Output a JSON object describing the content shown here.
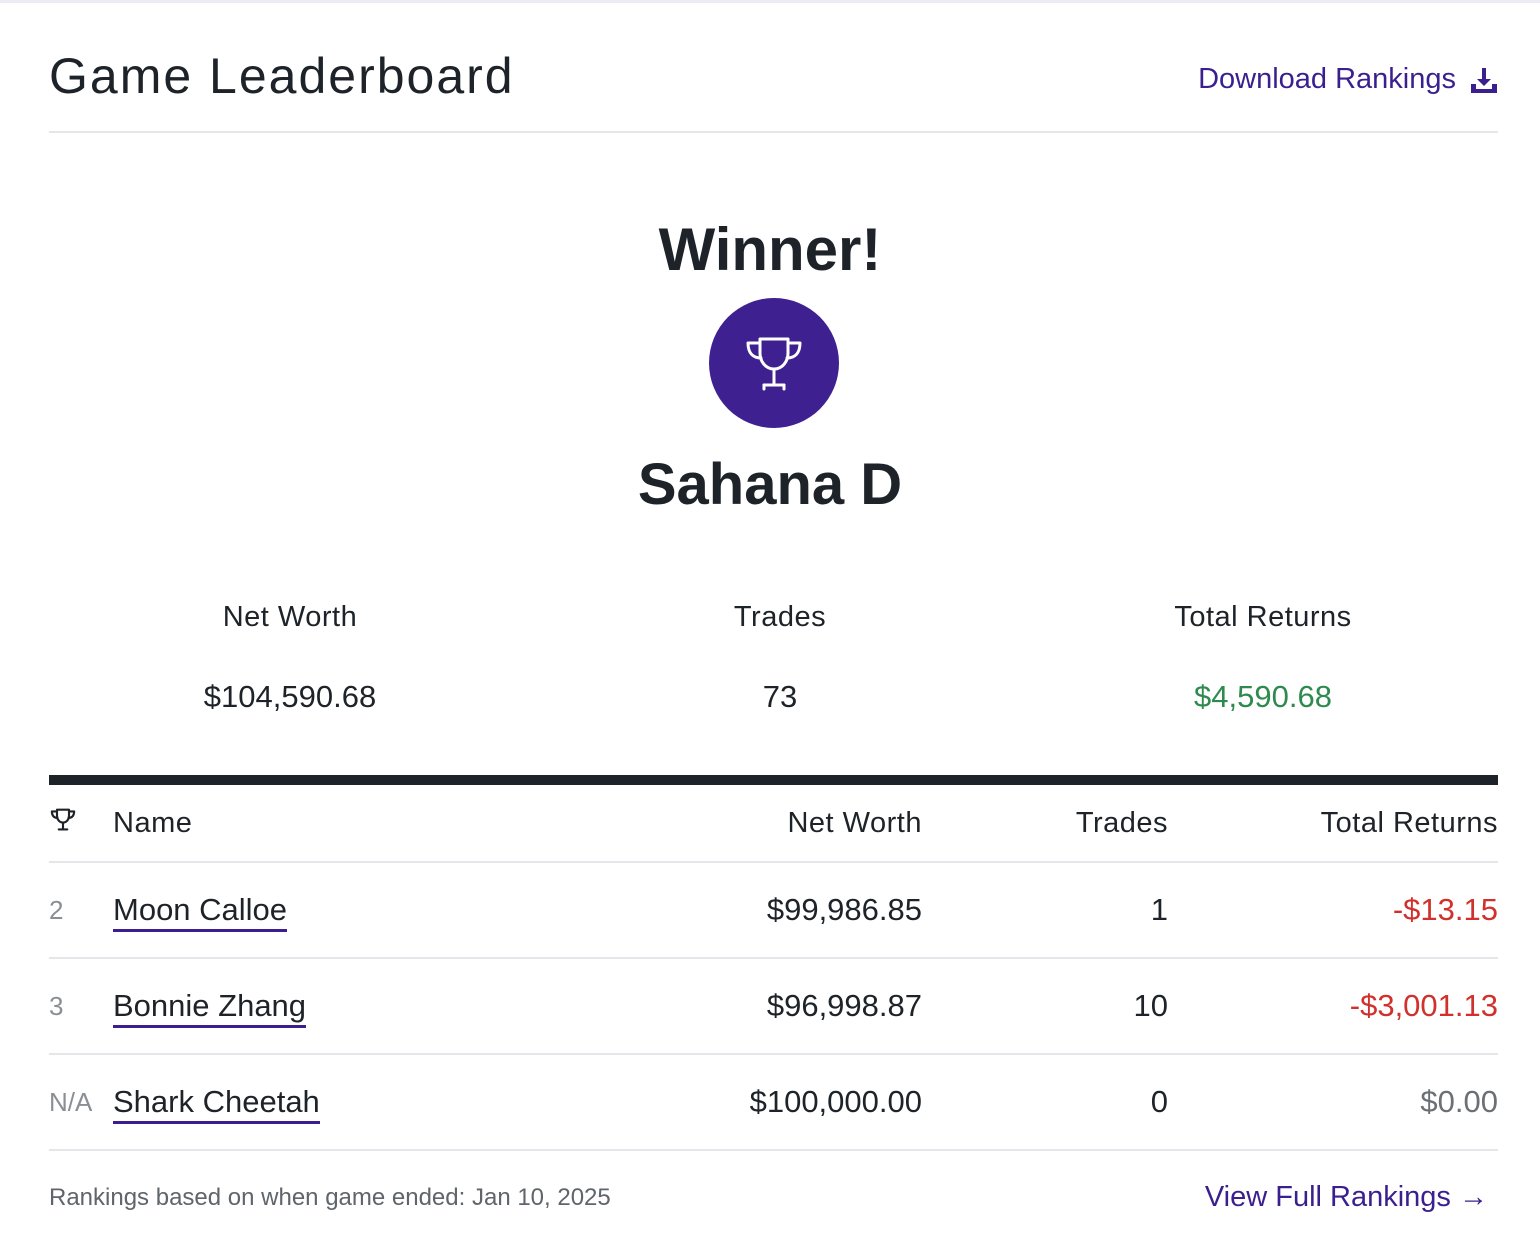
{
  "header": {
    "title": "Game Leaderboard",
    "download_label": "Download Rankings"
  },
  "winner": {
    "heading": "Winner!",
    "name": "Sahana D",
    "stats": [
      {
        "label": "Net Worth",
        "value": "$104,590.68"
      },
      {
        "label": "Trades",
        "value": "73"
      },
      {
        "label": "Total Returns",
        "value": "$4,590.68"
      }
    ]
  },
  "table": {
    "columns": {
      "name": "Name",
      "net_worth": "Net Worth",
      "trades": "Trades",
      "total_returns": "Total Returns"
    },
    "rows": [
      {
        "rank": "2",
        "name": "Moon Calloe",
        "net_worth": "$99,986.85",
        "trades": "1",
        "total_returns": "-$13.15"
      },
      {
        "rank": "3",
        "name": "Bonnie Zhang",
        "net_worth": "$96,998.87",
        "trades": "10",
        "total_returns": "-$3,001.13"
      },
      {
        "rank": "N/A",
        "name": "Shark Cheetah",
        "net_worth": "$100,000.00",
        "trades": "0",
        "total_returns": "$0.00"
      }
    ]
  },
  "footer": {
    "note": "Rankings based on when game ended: Jan 10, 2025",
    "view_full_label": "View Full Rankings →"
  },
  "colors": {
    "accent": "#3f2090",
    "link": "#3b1f8e",
    "positive": "#2e8a4e",
    "negative": "#d0312d"
  },
  "icons": {
    "download": "download-icon",
    "trophy": "trophy-icon"
  }
}
